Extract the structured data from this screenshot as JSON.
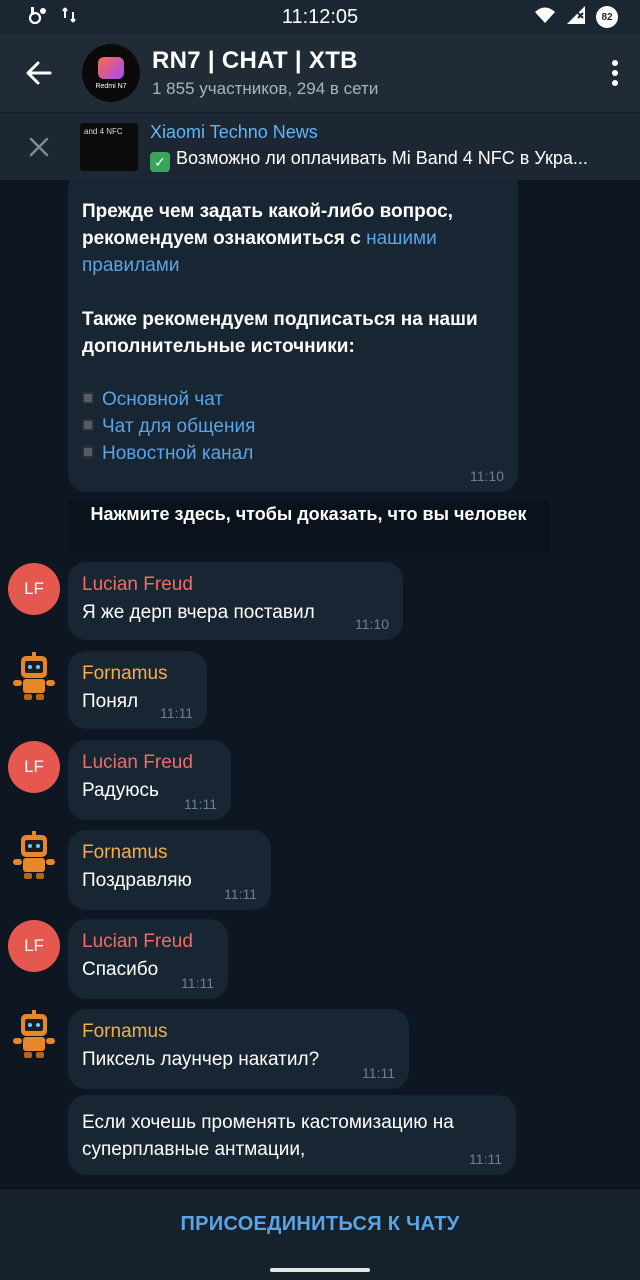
{
  "status_bar": {
    "time": "11:12:05",
    "battery": "82"
  },
  "header": {
    "title": "RN7 | CHAT | XTB",
    "subtitle": "1 855 участников, 294 в сети",
    "avatar_text": "Redmi N7"
  },
  "pinned": {
    "thumb_text": "and 4 NFC",
    "title": "Xiaomi Techno News",
    "message": "Возможно ли оплачивать Mi Band 4 NFC в Укра..."
  },
  "rules_message": {
    "para1_text": "Прежде чем задать какой-либо вопрос, рекомендуем ознакомиться с ",
    "para1_link": "нашими правилами",
    "para2_text": "Также рекомендуем подписаться на наши дополнительные источники:",
    "links": [
      "Основной чат",
      "Чат для общения",
      "Новостной канал"
    ],
    "time": "11:10"
  },
  "captcha": {
    "label": "Нажмите здесь, чтобы доказать, что вы человек"
  },
  "messages": [
    {
      "sender": "Lucian Freud",
      "initials": "LF",
      "text": "Я же дерп вчера поставил",
      "time": "11:10"
    },
    {
      "sender": "Fornamus",
      "text": "Понял",
      "time": "11:11"
    },
    {
      "sender": "Lucian Freud",
      "initials": "LF",
      "text": "Радуюсь",
      "time": "11:11"
    },
    {
      "sender": "Fornamus",
      "text": "Поздравляю",
      "time": "11:11"
    },
    {
      "sender": "Lucian Freud",
      "initials": "LF",
      "text": "Спасибо",
      "time": "11:11"
    },
    {
      "sender": "Fornamus",
      "text": "Пиксель лаунчер накатил?",
      "time": "11:11"
    },
    {
      "text": "Если хочешь променять кастомизацию на суперплавные антмации,",
      "time": "11:11"
    }
  ],
  "join_bar": {
    "label": "ПРИСОЕДИНИТЬСЯ К ЧАТУ"
  },
  "colors": {
    "background": "#0e1621",
    "bubble": "#182533",
    "link": "#5ba4e5",
    "sender_red": "#ee6e62",
    "sender_orange": "#f2b04a"
  }
}
